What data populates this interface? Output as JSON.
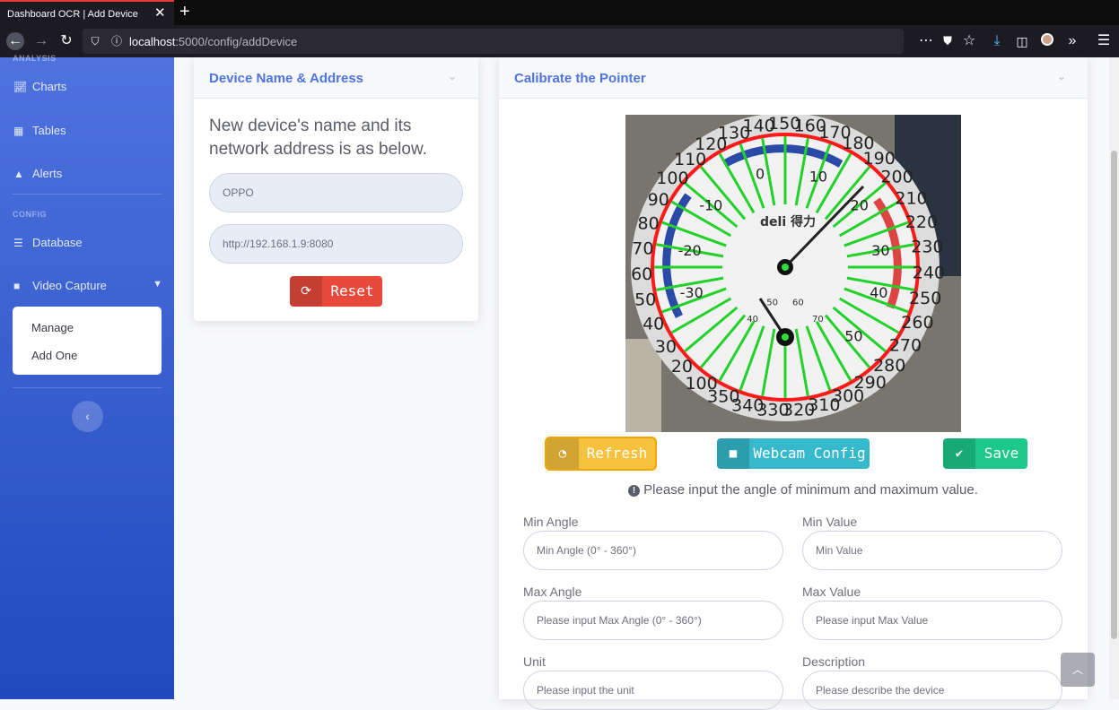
{
  "browser": {
    "tab_title": "Dashboard OCR | Add Device",
    "url_host": "localhost",
    "url_path": ":5000/config/addDevice"
  },
  "sidebar": {
    "section_analysis": "ANALYSIS",
    "items": [
      {
        "label": "Charts",
        "icon": "chart-area-icon"
      },
      {
        "label": "Tables",
        "icon": "table-icon"
      },
      {
        "label": "Alerts",
        "icon": "warning-icon"
      }
    ],
    "section_config": "CONFIG",
    "config_items": [
      {
        "label": "Database",
        "icon": "database-icon"
      },
      {
        "label": "Video Capture",
        "icon": "video-icon"
      }
    ],
    "submenu": [
      "Manage",
      "Add One"
    ]
  },
  "device_card": {
    "title": "Device Name & Address",
    "lead": "New device's name and its network address is as below.",
    "name_value": "OPPO",
    "address_value": "http://192.168.1.9:8080",
    "reset_label": "Reset"
  },
  "calibrate_card": {
    "title": "Calibrate the Pointer",
    "refresh_label": "Refresh",
    "webcam_label": "Webcam Config",
    "save_label": "Save",
    "info_text": "Please input the angle of minimum and maximum value.",
    "fields": {
      "min_angle_label": "Min Angle",
      "min_angle_placeholder": "Min Angle (0° - 360°)",
      "min_value_label": "Min Value",
      "min_value_placeholder": "Min Value",
      "max_angle_label": "Max Angle",
      "max_angle_placeholder": "Please input Max Angle (0° - 360°)",
      "max_value_label": "Max Value",
      "max_value_placeholder": "Please input Max Value",
      "unit_label": "Unit",
      "unit_placeholder": "Please input the unit",
      "description_label": "Description",
      "description_placeholder": "Please describe the device"
    },
    "gauge": {
      "outer_scale": [
        "160",
        "170",
        "180",
        "190",
        "200",
        "210",
        "220",
        "230",
        "240",
        "250",
        "260",
        "270",
        "280",
        "290",
        "300",
        "310",
        "320",
        "330",
        "340",
        "350",
        "100",
        "20",
        "30",
        "40",
        "50",
        "60",
        "70",
        "80",
        "90",
        "100",
        "110",
        "120",
        "130",
        "140",
        "150"
      ],
      "inner_scale": [
        "0",
        "10",
        "20",
        "30",
        "40",
        "50",
        "-10",
        "-20",
        "-30"
      ],
      "brand": "deli 得力",
      "small_scale": [
        "40",
        "50",
        "60",
        "70"
      ]
    }
  },
  "colors": {
    "primary": "#4e73df",
    "warning": "#f6c23e",
    "info": "#36b9cc",
    "success": "#1cc88a",
    "danger": "#e74a3b"
  }
}
